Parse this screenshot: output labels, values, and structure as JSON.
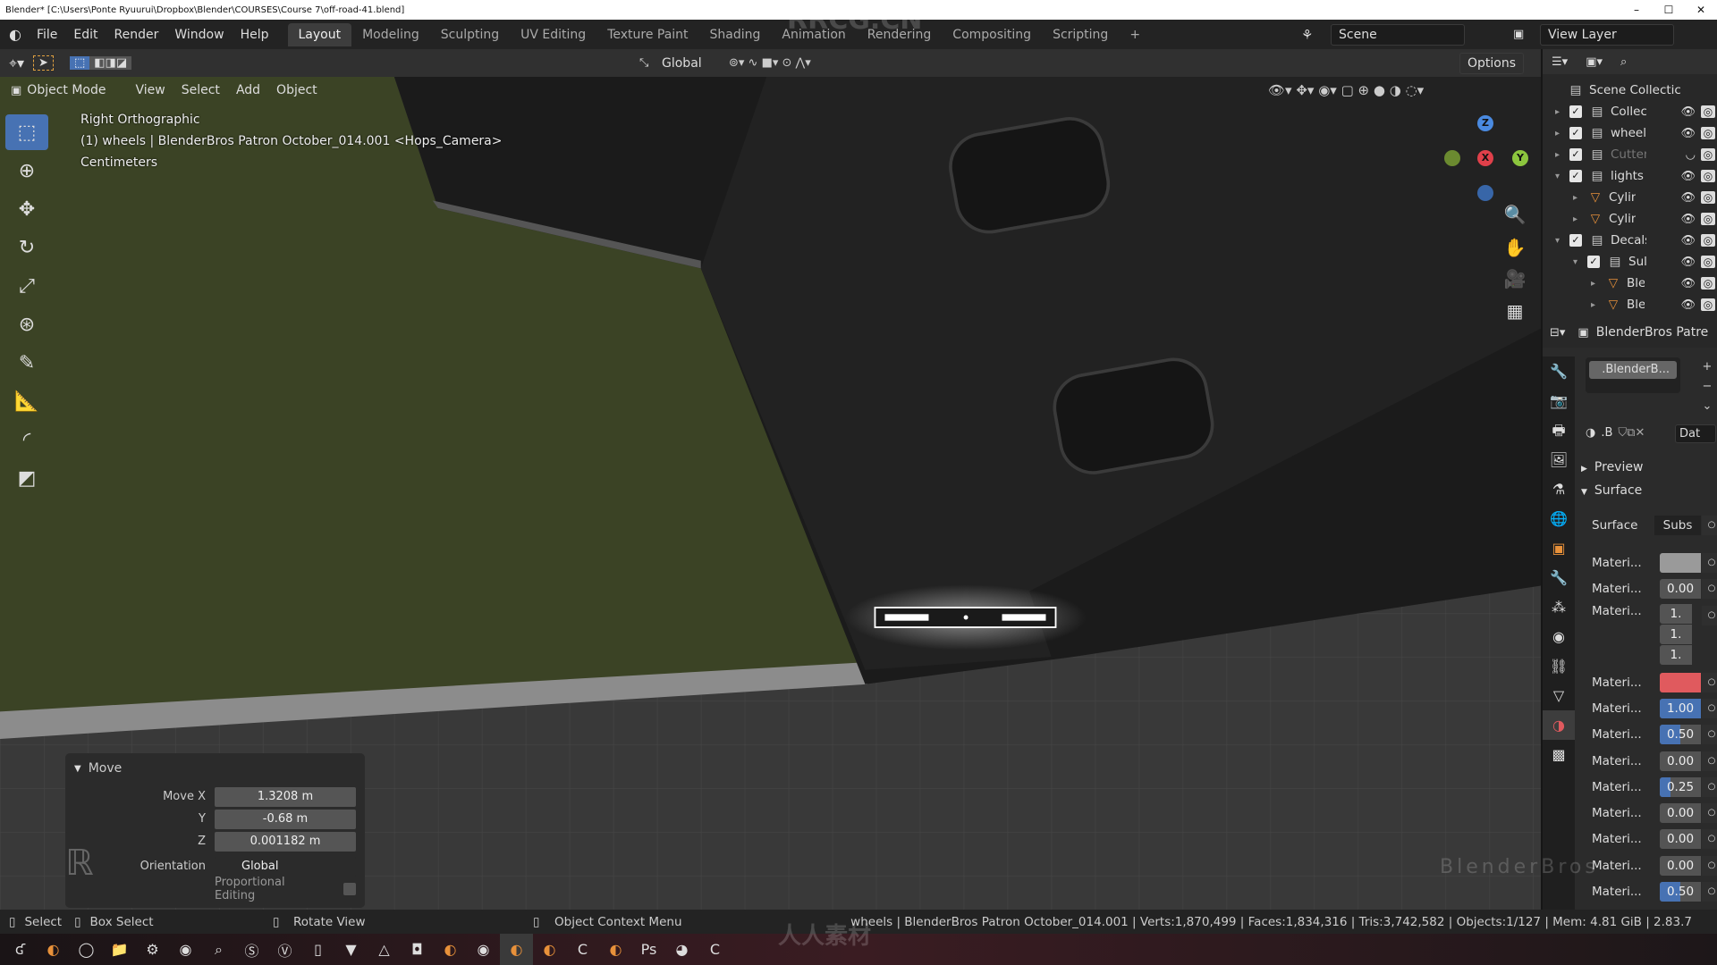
{
  "window": {
    "title": "Blender* [C:\\Users\\Ponte Ryuurui\\Dropbox\\Blender\\COURSES\\Course 7\\off-road-41.blend]",
    "controls": [
      "–",
      "☐",
      "✕"
    ]
  },
  "menu": [
    "File",
    "Edit",
    "Render",
    "Window",
    "Help"
  ],
  "workspaces": [
    {
      "label": "Layout",
      "active": true
    },
    {
      "label": "Modeling"
    },
    {
      "label": "Sculpting"
    },
    {
      "label": "UV Editing"
    },
    {
      "label": "Texture Paint"
    },
    {
      "label": "Shading"
    },
    {
      "label": "Animation"
    },
    {
      "label": "Rendering"
    },
    {
      "label": "Compositing"
    },
    {
      "label": "Scripting"
    }
  ],
  "add_workspace": "+",
  "scene": {
    "label": "Scene",
    "view_layer": "View Layer"
  },
  "tool_header": {
    "orientation": "Global",
    "options": "Options"
  },
  "viewport_header": {
    "mode": "Object Mode",
    "menus": [
      "View",
      "Select",
      "Add",
      "Object"
    ]
  },
  "viewport": {
    "view_name": "Right Orthographic",
    "object_info": "(1) wheels | BlenderBros Patron October_014.001 <Hops_Camera>",
    "units": "Centimeters",
    "axes": {
      "x": "X",
      "y": "Y",
      "z": "Z"
    },
    "colors": {
      "plane": "#3b4325",
      "object": "#1a1a1a",
      "grid": "#3a3a3a"
    }
  },
  "operator_panel": {
    "title": "Move",
    "rows": [
      {
        "label": "Move X",
        "value": "1.3208 m"
      },
      {
        "label": "Y",
        "value": "-0.68 m"
      },
      {
        "label": "Z",
        "value": "0.001182 m"
      }
    ],
    "orientation_label": "Orientation",
    "orientation": "Global",
    "proportional": "Proportional Editing",
    "proportional_checked": false
  },
  "outliner": {
    "root": "Scene Collectic",
    "items": [
      {
        "name": "Collecti",
        "type": "collection",
        "depth": 0,
        "expanded": false
      },
      {
        "name": "wheels",
        "type": "collection",
        "depth": 0,
        "expanded": false
      },
      {
        "name": "Cutters",
        "type": "collection",
        "depth": 0,
        "expanded": false,
        "hidden": true
      },
      {
        "name": "lights c",
        "type": "collection",
        "depth": 0,
        "expanded": true
      },
      {
        "name": "Cylinde",
        "type": "mesh",
        "depth": 1
      },
      {
        "name": "Cylinde",
        "type": "mesh",
        "depth": 1
      },
      {
        "name": "Decals",
        "type": "collection",
        "depth": 0,
        "expanded": true
      },
      {
        "name": "Sul",
        "type": "collection",
        "depth": 1,
        "expanded": true
      },
      {
        "name": "Ble",
        "type": "mesh",
        "depth": 2
      },
      {
        "name": "Ble",
        "type": "mesh",
        "depth": 2
      }
    ]
  },
  "properties": {
    "object_name": "BlenderBros Patre",
    "material_slot": ".BlenderB...",
    "material_name": ".B",
    "data_dropdown": "Dat",
    "panels": {
      "preview": "Preview",
      "surface": "Surface"
    },
    "surface_label": "Surface",
    "surface_value": "Subs",
    "rows": [
      {
        "label": "Materi...",
        "type": "color",
        "color": "#9a9a9a"
      },
      {
        "label": "Materi...",
        "value": "0.00",
        "fill": 0
      },
      {
        "label": "Materi...",
        "type": "vector",
        "values": [
          "1.",
          "1.",
          "1."
        ]
      },
      {
        "label": "Materi...",
        "type": "color",
        "color": "#e05a5e"
      },
      {
        "label": "Materi...",
        "value": "1.00",
        "fill": 1
      },
      {
        "label": "Materi...",
        "value": "0.50",
        "fill": 0.5
      },
      {
        "label": "Materi...",
        "value": "0.00",
        "fill": 0
      },
      {
        "label": "Materi...",
        "value": "0.25",
        "fill": 0.25
      },
      {
        "label": "Materi...",
        "value": "0.00",
        "fill": 0
      },
      {
        "label": "Materi...",
        "value": "0.00",
        "fill": 0
      },
      {
        "label": "Materi...",
        "value": "0.00",
        "fill": 0
      },
      {
        "label": "Materi...",
        "value": "0.50",
        "fill": 0.5
      }
    ]
  },
  "statusbar": {
    "select": "Select",
    "box_select": "Box Select",
    "rotate": "Rotate View",
    "context": "Object Context Menu",
    "stats": "wheels | BlenderBros Patron October_014.001 | Verts:1,870,499 | Faces:1,834,316 | Tris:3,742,582 | Objects:1/127 | Mem: 4.81 GiB | 2.83.7"
  },
  "watermarks": {
    "top": "RRCG.CN",
    "logo": "人人素材",
    "brand": "BlenderBros"
  }
}
